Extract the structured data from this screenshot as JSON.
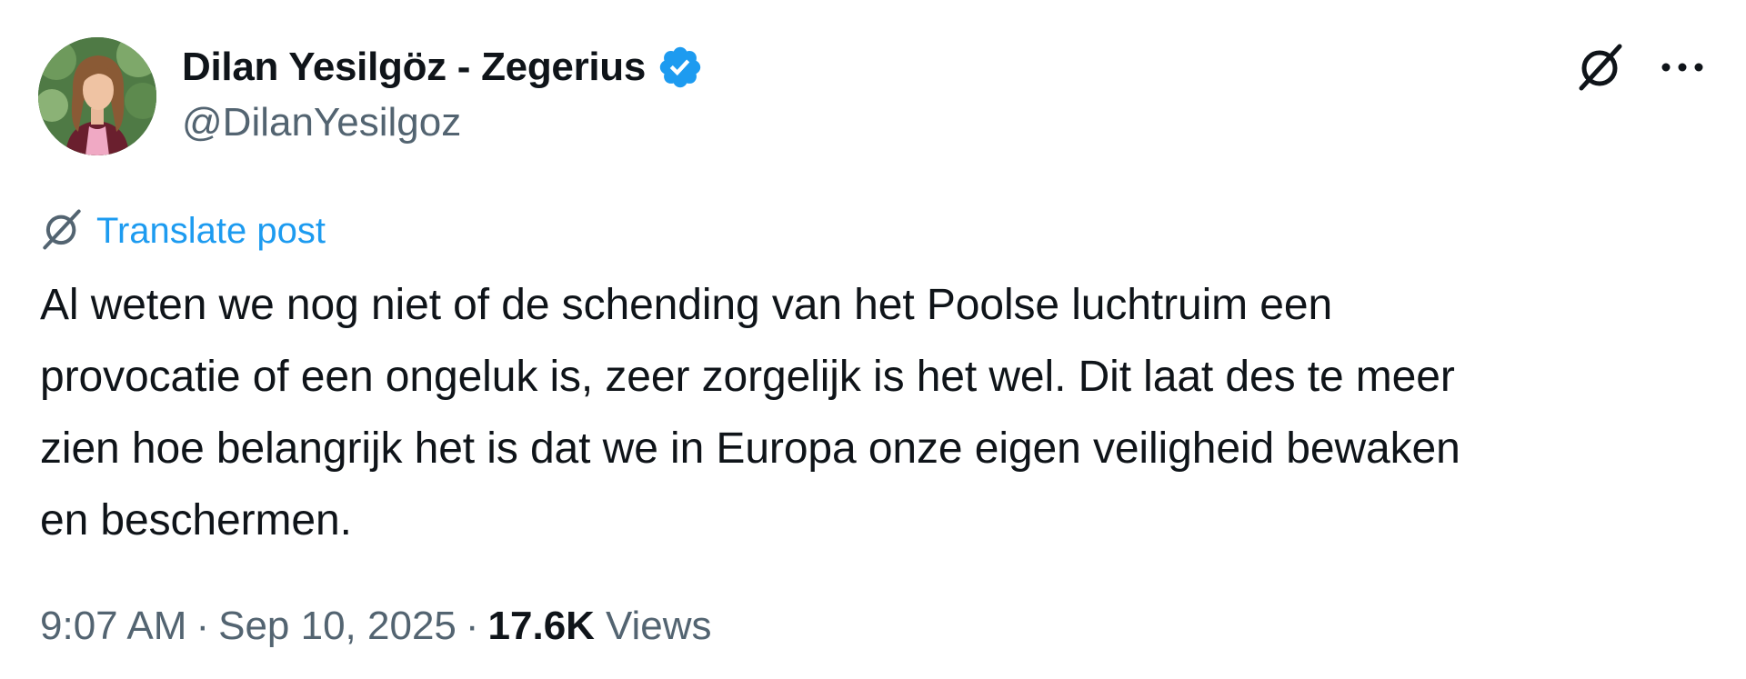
{
  "author": {
    "name": "Dilan Yesilgöz - Zegerius",
    "handle": "@DilanYesilgoz",
    "verified": true,
    "verified_color": "#1d9bf0"
  },
  "actions": {
    "grok_icon": "grok-icon",
    "more_icon": "more-icon"
  },
  "translate": {
    "label": "Translate post",
    "color": "#1d9bf0"
  },
  "post": {
    "text": "Al weten we nog niet of de schending van het Poolse luchtruim een\nprovocatie of een ongeluk is, zeer zorgelijk is het wel. Dit laat des te meer\nzien hoe belangrijk het is dat we in Europa onze eigen veiligheid bewaken\nen beschermen."
  },
  "meta": {
    "time": "9:07 AM",
    "separator": "·",
    "date": "Sep 10, 2025",
    "views_count": "17.6K",
    "views_label": "Views"
  }
}
